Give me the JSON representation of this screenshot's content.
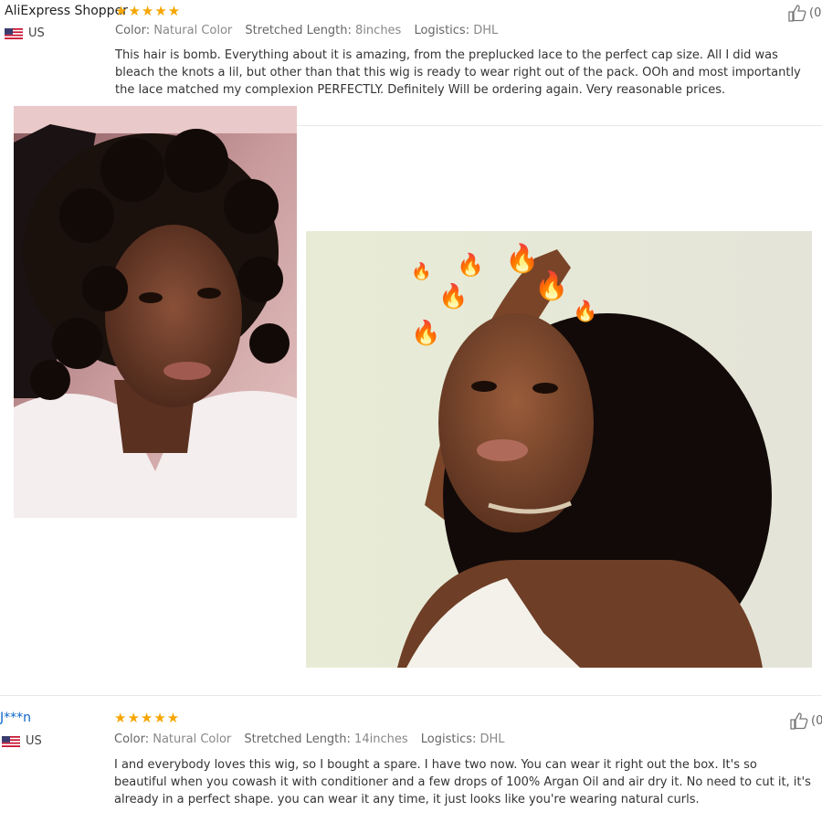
{
  "reviews": [
    {
      "author": "AliExpress Shopper",
      "rating": 5,
      "stars": "★★★★★",
      "country": "US",
      "color_key": "Color:",
      "color_val": "Natural Color",
      "length_key": "Stretched Length:",
      "length_val": "8inches",
      "logistics_key": "Logistics:",
      "logistics_val": "DHL",
      "text": "This hair is bomb. Everything about it is amazing, from the preplucked lace to the perfect cap size. All I did was bleach the knots a lil, but other than that this wig is ready to wear right out of the pack. OOh and most importantly the lace matched my complexion PERFECTLY. Definitely Will be ordering again. Very reasonable prices.",
      "helpful": "(0"
    },
    {
      "author": "J***n",
      "rating": 5,
      "stars": "★★★★★",
      "country": "US",
      "color_key": "Color:",
      "color_val": "Natural Color",
      "length_key": "Stretched Length:",
      "length_val": "14inches",
      "logistics_key": "Logistics:",
      "logistics_val": "DHL",
      "text": "I and everybody loves this wig, so I bought a spare. I have two now. You can wear it right out the box. It's so beautiful when you cowash it with conditioner and a few drops of 100% Argan Oil and air dry it. No need to cut it, it's already in a perfect shape. you can wear it any time, it just looks like you're wearing natural curls.",
      "helpful": "(0"
    }
  ],
  "colors": {
    "star": "#f7a600",
    "author_link": "#0a64c8"
  },
  "icons": [
    "us-flag-icon",
    "thumbs-up-icon",
    "fire-emoji-icon"
  ]
}
